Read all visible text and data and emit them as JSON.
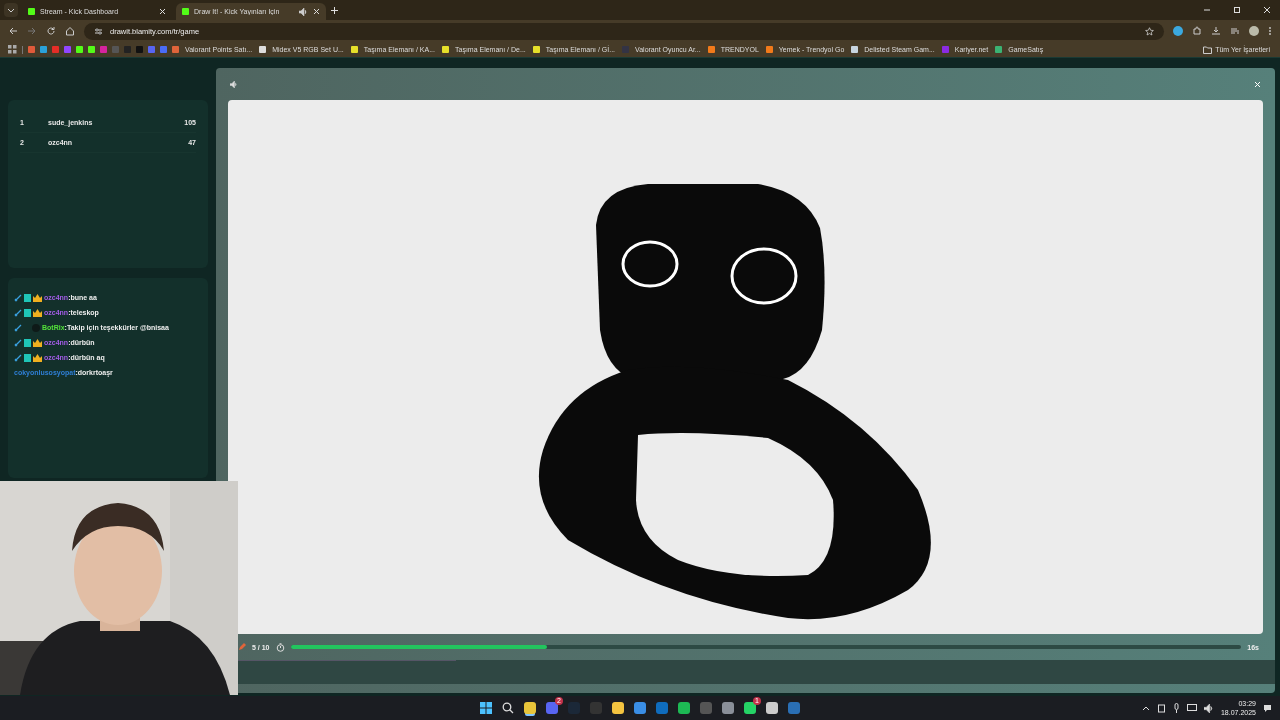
{
  "browser": {
    "tabs": [
      {
        "title": "Stream - Kick Dashboard",
        "selected": false,
        "audio": false
      },
      {
        "title": "Draw It! - Kick Yayınları İçin",
        "selected": true,
        "audio": true
      }
    ],
    "url": "drawit.blamity.com/tr/game",
    "icon_bookmarks": [
      {
        "color": "#e05a3a"
      },
      {
        "color": "#2aa1d8"
      },
      {
        "color": "#e52d27"
      },
      {
        "color": "#9146ff"
      },
      {
        "color": "#53fc18"
      },
      {
        "color": "#53fc18"
      },
      {
        "color": "#d6249f"
      },
      {
        "color": "#555555"
      },
      {
        "color": "#222222"
      },
      {
        "color": "#111111"
      },
      {
        "color": "#5865f2"
      },
      {
        "color": "#4a6cf7"
      }
    ],
    "bookmarks": [
      {
        "label": "Valorant Points Satı...",
        "color": "#e0643a"
      },
      {
        "label": "Midex V5 RGB Set U...",
        "color": "#dddddd"
      },
      {
        "label": "Taşıma Elemanı / KA...",
        "color": "#e6e02a"
      },
      {
        "label": "Taşıma Elemanı / De...",
        "color": "#e6e02a"
      },
      {
        "label": "Taşıma Elemanı / Gİ...",
        "color": "#e6e02a"
      },
      {
        "label": "Valorant Oyuncu Ar...",
        "color": "#333344"
      },
      {
        "label": "TRENDYOL",
        "color": "#f27a1a"
      },
      {
        "label": "Yemek - Trendyol Go",
        "color": "#f27a1a"
      },
      {
        "label": "Delisted Steam Gam...",
        "color": "#c7d5e0"
      },
      {
        "label": "Kariyer.net",
        "color": "#8a2be2"
      },
      {
        "label": "GameSatış",
        "color": "#3bb273"
      }
    ],
    "all_bookmarks": "Tüm Yer İşaretleri"
  },
  "leaderboard": [
    {
      "rank": "1",
      "name": "sude_jenkins",
      "score": "105"
    },
    {
      "rank": "2",
      "name": "ozc4nn",
      "score": "47"
    }
  ],
  "chat": [
    {
      "kind": "badged",
      "user": "ozc4nn",
      "color": "#a35ce6",
      "text": ":bune aa"
    },
    {
      "kind": "badged",
      "user": "ozc4nn",
      "color": "#a35ce6",
      "text": ":teleskop"
    },
    {
      "kind": "bot",
      "user": "BotRix",
      "color": "#53e03a",
      "text": ":Takip için teşekkürler @bnisaa"
    },
    {
      "kind": "badged",
      "user": "ozc4nn",
      "color": "#a35ce6",
      "text": ":dürbün"
    },
    {
      "kind": "badged",
      "user": "ozc4nn",
      "color": "#a35ce6",
      "text": ":dürbün aq"
    },
    {
      "kind": "plain",
      "user": "cokyonlusosyopat",
      "color": "#2f7fd6",
      "text": ":dorkrtoaşr"
    }
  ],
  "game": {
    "round": "5 / 10",
    "level": 0.27,
    "time": "16s"
  },
  "taskbar": {
    "apps": [
      {
        "color": "#e8c53a",
        "selected": true
      },
      {
        "color": "#5865f2",
        "selected": false,
        "badge": "2"
      },
      {
        "color": "#1b2838",
        "selected": false
      },
      {
        "color": "#333333",
        "selected": false
      },
      {
        "color": "#f3c340",
        "selected": false
      },
      {
        "color": "#3a8ee6",
        "selected": false
      },
      {
        "color": "#0f6cbd",
        "selected": false
      },
      {
        "color": "#1db954",
        "selected": false
      },
      {
        "color": "#555555",
        "selected": false
      },
      {
        "color": "#8a8f99",
        "selected": false
      },
      {
        "color": "#25d366",
        "selected": false,
        "badge": "1"
      },
      {
        "color": "#cccccc",
        "selected": false
      },
      {
        "color": "#2a6fb5",
        "selected": false
      }
    ],
    "time": "03:29",
    "date": "18.07.2025"
  }
}
